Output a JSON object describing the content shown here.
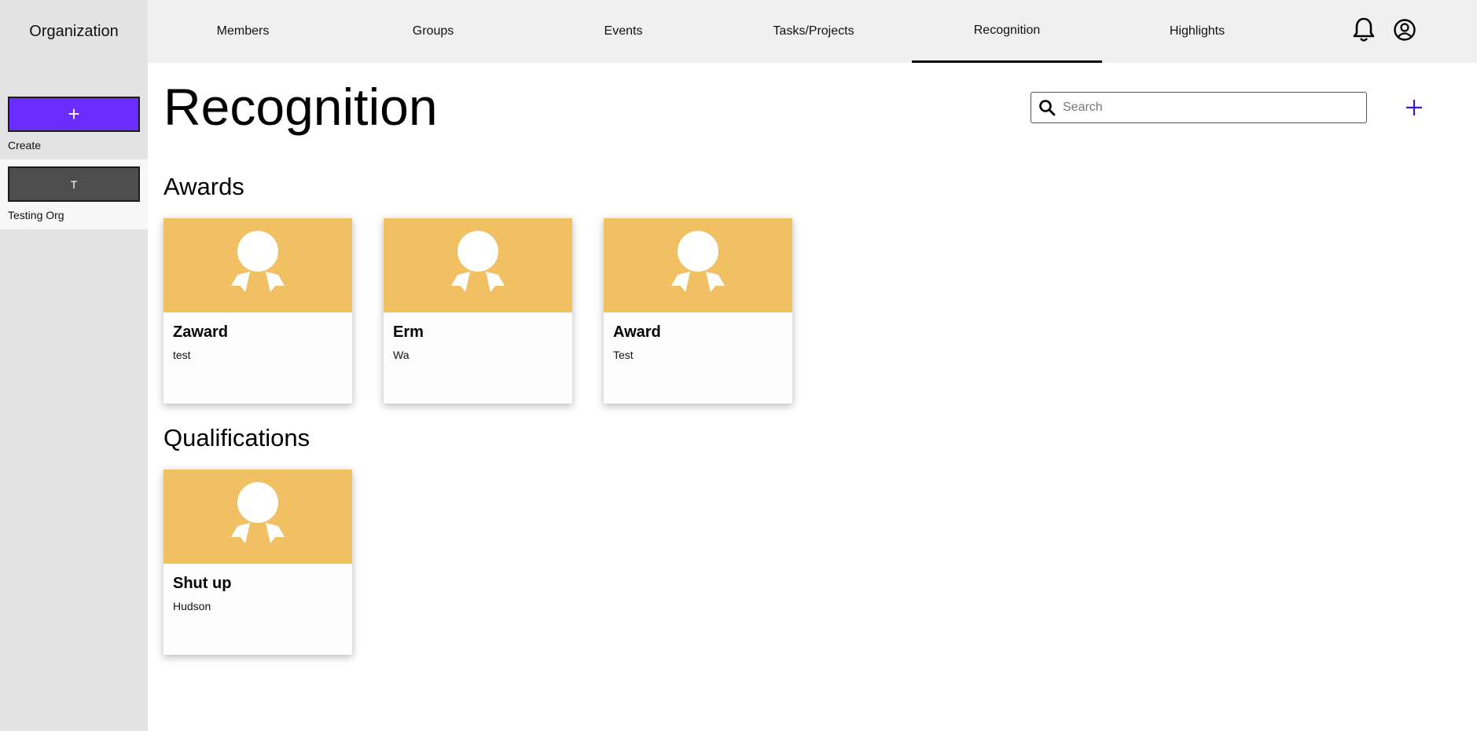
{
  "sidebar": {
    "title": "Organization",
    "create": {
      "icon_label": "+",
      "label": "Create"
    },
    "orgs": [
      {
        "initial": "T",
        "label": "Testing Org"
      }
    ]
  },
  "nav": {
    "tabs": [
      {
        "label": "Members"
      },
      {
        "label": "Groups"
      },
      {
        "label": "Events"
      },
      {
        "label": "Tasks/Projects"
      },
      {
        "label": "Recognition",
        "active": true
      },
      {
        "label": "Highlights"
      }
    ],
    "icons": [
      "bell-icon",
      "account-circle-icon"
    ]
  },
  "page": {
    "title": "Recognition",
    "search": {
      "placeholder": "Search",
      "value": ""
    },
    "add_icon": "plus-icon"
  },
  "sections": {
    "awards": {
      "title": "Awards",
      "items": [
        {
          "name": "Zaward",
          "description": "test"
        },
        {
          "name": "Erm",
          "description": "Wa"
        },
        {
          "name": "Award",
          "description": "Test"
        }
      ]
    },
    "qualifications": {
      "title": "Qualifications",
      "items": [
        {
          "name": "Shut up",
          "description": "Hudson"
        }
      ]
    }
  },
  "colors": {
    "accent": "#6a2cff",
    "card_banner": "#f0c063",
    "plus_icon": "#3b16c9"
  }
}
